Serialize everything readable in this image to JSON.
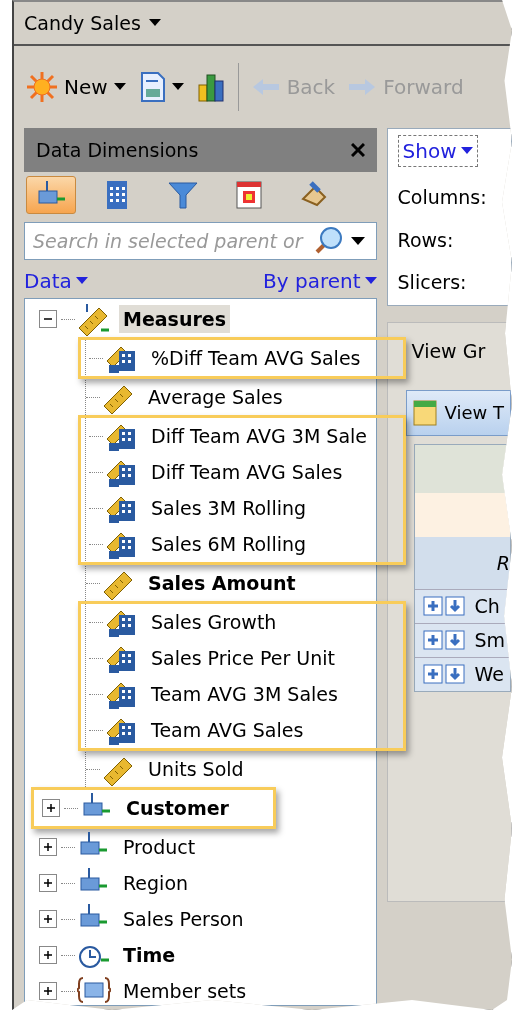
{
  "window": {
    "title": "Candy Sales"
  },
  "toolbar": [
    {
      "kind": "new",
      "label": "New",
      "disabled": false
    },
    {
      "kind": "report",
      "disabled": false
    },
    {
      "kind": "chart",
      "disabled": false
    },
    {
      "kind": "back",
      "label": "Back",
      "disabled": true
    },
    {
      "kind": "forward",
      "label": "Forward",
      "disabled": true
    }
  ],
  "panel": {
    "title": "Data Dimensions",
    "tools": [
      {
        "kind": "dimensions",
        "selected": true
      },
      {
        "kind": "calculator",
        "selected": false
      },
      {
        "kind": "filter",
        "selected": false
      },
      {
        "kind": "calendar",
        "selected": false
      },
      {
        "kind": "eraser",
        "selected": false
      }
    ],
    "search": {
      "placeholder": "Search in selected parent or"
    },
    "view_menu": "Data",
    "sort_menu": "By parent",
    "tree": [
      {
        "label": "Measures",
        "kind": "measures",
        "bold": true,
        "expanded": true,
        "selected": true,
        "highlighted": false,
        "children": [
          {
            "label": "%Diff Team AVG Sales",
            "kind": "calculated",
            "bold": false,
            "highlighted": true
          },
          {
            "label": "Average Sales",
            "kind": "measure",
            "bold": false,
            "highlighted": false
          },
          {
            "label": "Diff Team AVG 3M Sale",
            "kind": "calculated",
            "bold": false,
            "highlighted": true
          },
          {
            "label": "Diff Team AVG Sales",
            "kind": "calculated",
            "bold": false,
            "highlighted": true
          },
          {
            "label": "Sales 3M Rolling",
            "kind": "calculated",
            "bold": false,
            "highlighted": true
          },
          {
            "label": "Sales 6M Rolling",
            "kind": "calculated",
            "bold": false,
            "highlighted": true
          },
          {
            "label": "Sales Amount",
            "kind": "measure",
            "bold": true,
            "highlighted": false
          },
          {
            "label": "Sales Growth",
            "kind": "calculated",
            "bold": false,
            "highlighted": true
          },
          {
            "label": "Sales Price Per Unit",
            "kind": "calculated",
            "bold": false,
            "highlighted": true
          },
          {
            "label": "Team AVG 3M Sales",
            "kind": "calculated",
            "bold": false,
            "highlighted": true
          },
          {
            "label": "Team AVG Sales",
            "kind": "calculated",
            "bold": false,
            "highlighted": true
          },
          {
            "label": "Units Sold",
            "kind": "measure",
            "bold": false,
            "highlighted": false
          }
        ]
      },
      {
        "label": "Customer",
        "kind": "dimension",
        "bold": true,
        "expanded": false,
        "selected": false,
        "highlighted": true
      },
      {
        "label": "Product",
        "kind": "dimension",
        "bold": false,
        "expanded": false,
        "selected": false,
        "highlighted": false
      },
      {
        "label": "Region",
        "kind": "dimension",
        "bold": false,
        "expanded": false,
        "selected": false,
        "highlighted": false
      },
      {
        "label": "Sales Person",
        "kind": "dimension",
        "bold": false,
        "expanded": false,
        "selected": false,
        "highlighted": false
      },
      {
        "label": "Time",
        "kind": "time",
        "bold": true,
        "expanded": false,
        "selected": false,
        "highlighted": false
      },
      {
        "label": "Member sets",
        "kind": "set",
        "bold": false,
        "expanded": false,
        "selected": false,
        "highlighted": false
      }
    ]
  },
  "layout": {
    "show_menu": "Show",
    "axes": [
      "Columns:",
      "Rows:",
      "Slicers:"
    ],
    "tabs": [
      "View Gr",
      "View T"
    ],
    "header": "R",
    "rows": [
      "Ch",
      "Sm",
      "We"
    ]
  }
}
